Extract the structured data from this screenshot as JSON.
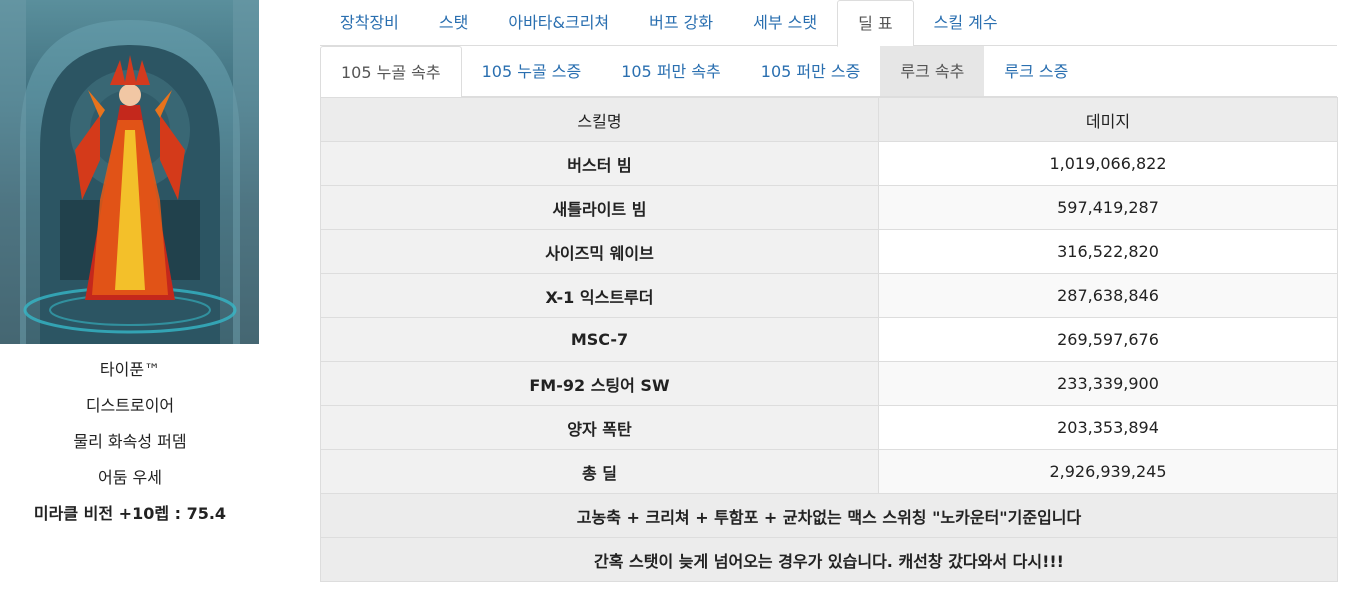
{
  "character": {
    "name": "타이푼™",
    "job": "디스트로이어",
    "element": "물리 화속성 퍼뎀",
    "dark_advantage": "어둠 우세",
    "weapon_info": "미라클 비전 +10렙 : 75.4"
  },
  "main_tabs": [
    {
      "label": "장착장비",
      "active": false
    },
    {
      "label": "스탯",
      "active": false
    },
    {
      "label": "아바타&크리쳐",
      "active": false
    },
    {
      "label": "버프 강화",
      "active": false
    },
    {
      "label": "세부 스탯",
      "active": false
    },
    {
      "label": "딜 표",
      "active": true
    },
    {
      "label": "스킬 계수",
      "active": false
    }
  ],
  "sub_tabs": [
    {
      "label": "105 누골 속추",
      "active": true
    },
    {
      "label": "105 누골 스증",
      "active": false
    },
    {
      "label": "105 퍼만 속추",
      "active": false
    },
    {
      "label": "105 퍼만 스증",
      "active": false
    },
    {
      "label": "루크 속추",
      "active": false
    },
    {
      "label": "루크 스증",
      "active": false
    }
  ],
  "table": {
    "headers": {
      "skill": "스킬명",
      "damage": "데미지"
    },
    "rows": [
      {
        "skill": "버스터 빔",
        "damage": "1,019,066,822"
      },
      {
        "skill": "새틀라이트 빔",
        "damage": "597,419,287"
      },
      {
        "skill": "사이즈믹 웨이브",
        "damage": "316,522,820"
      },
      {
        "skill": "X-1 익스트루더",
        "damage": "287,638,846"
      },
      {
        "skill": "MSC-7",
        "damage": "269,597,676"
      },
      {
        "skill": "FM-92 스팅어 SW",
        "damage": "233,339,900"
      },
      {
        "skill": "양자 폭탄",
        "damage": "203,353,894"
      },
      {
        "skill": "총 딜",
        "damage": "2,926,939,245"
      }
    ],
    "notes": [
      "고농축 + 크리쳐 + 투함포 + 균차없는 맥스 스위칭 \"노카운터\"기준입니다",
      "간혹 스탯이 늦게 넘어오는 경우가 있습니다. 캐선창 갔다와서 다시!!!"
    ]
  }
}
